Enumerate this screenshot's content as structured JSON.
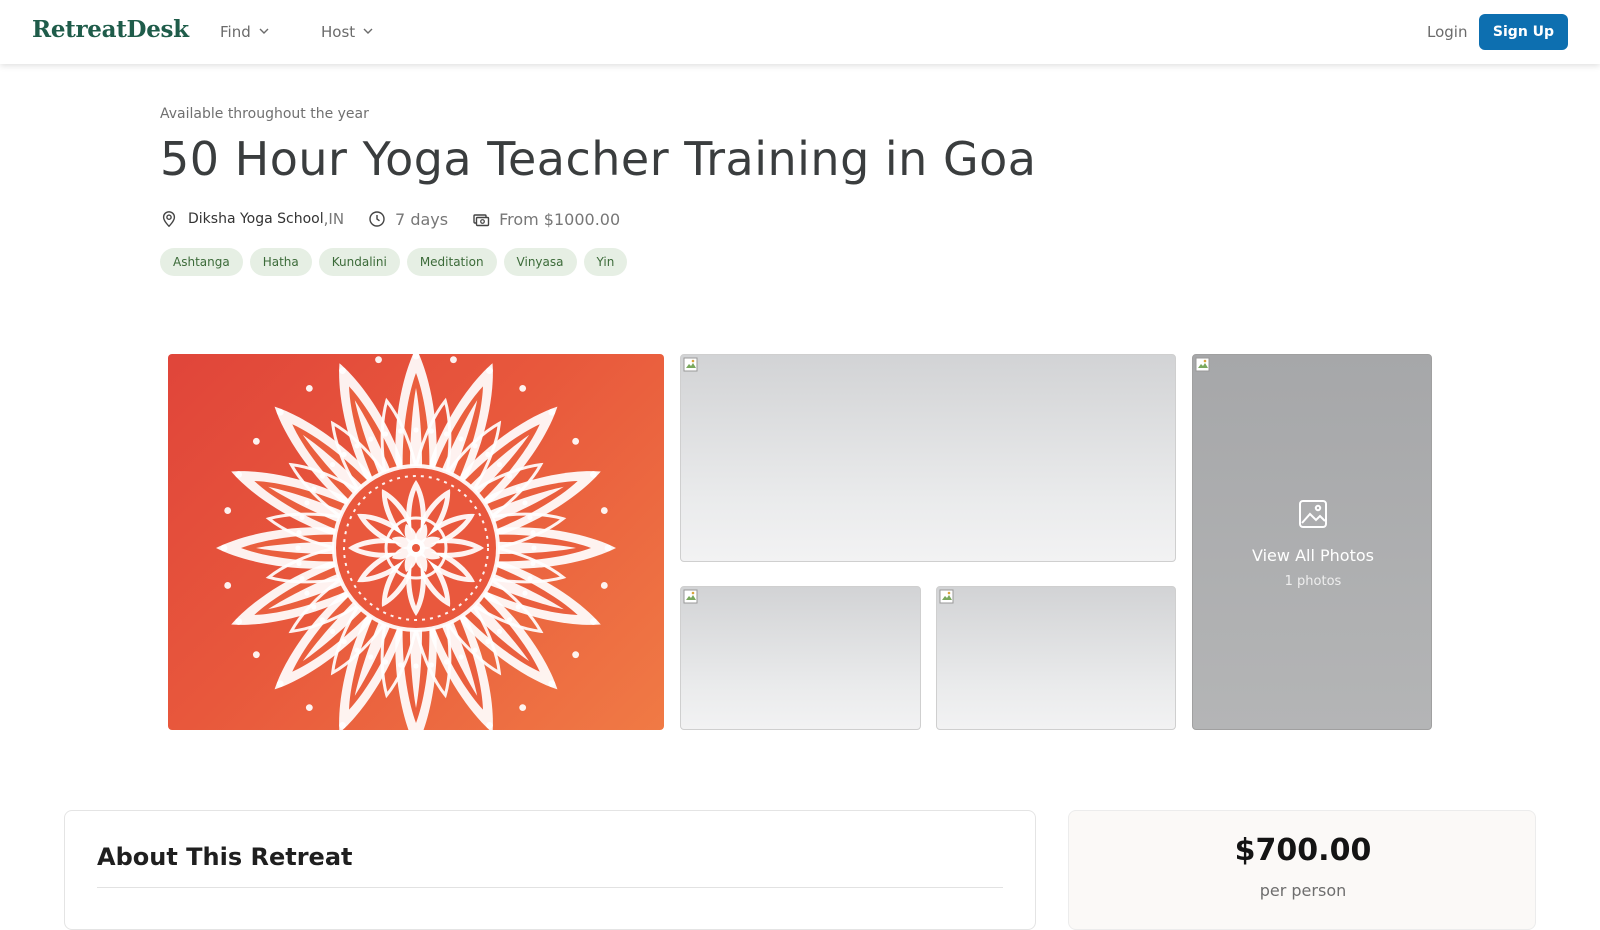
{
  "header": {
    "logo": "RetreatDesk",
    "nav": [
      {
        "label": "Find",
        "icon": "chevron-down-icon"
      },
      {
        "label": "Host",
        "icon": "chevron-down-icon"
      }
    ],
    "login_label": "Login",
    "signup_label": "Sign Up"
  },
  "retreat": {
    "availability": "Available throughout the year",
    "title": "50 Hour Yoga Teacher Training in Goa",
    "school": "Diksha Yoga School",
    "country": ",IN",
    "duration": "7 days",
    "price_from": "From $1000.00",
    "tags": [
      "Ashtanga",
      "Hatha",
      "Kundalini",
      "Meditation",
      "Vinyasa",
      "Yin"
    ]
  },
  "gallery": {
    "view_all_label": "View All Photos",
    "photo_count": "1 photos"
  },
  "about": {
    "title": "About This Retreat"
  },
  "pricing": {
    "price": "$700.00",
    "per": "per person"
  },
  "colors": {
    "brand": "#1f5c4a",
    "primary_button": "#0d6fb0",
    "tag_bg": "#e6efe4",
    "tag_text": "#3c6b39",
    "mandala_bg": "#e8583c"
  }
}
